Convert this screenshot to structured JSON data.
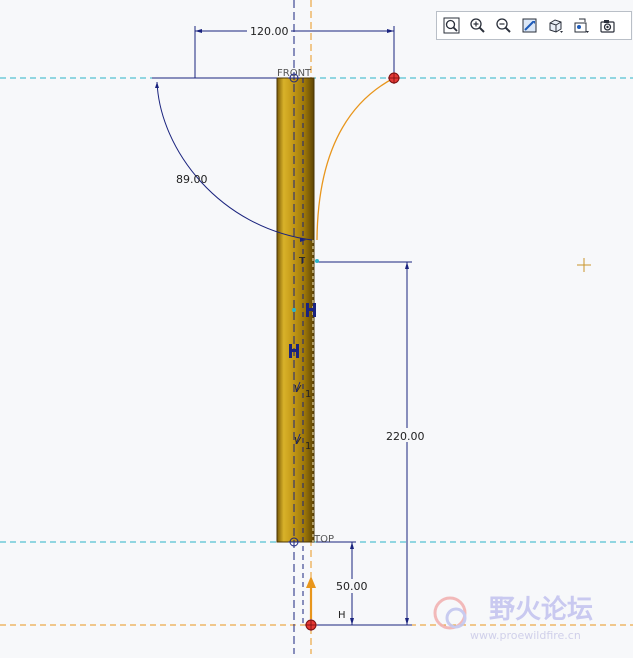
{
  "toolbar": {
    "buttons": [
      {
        "icon": "zoom-fit-icon"
      },
      {
        "icon": "zoom-in-icon"
      },
      {
        "icon": "zoom-out-icon"
      },
      {
        "icon": "repaint-icon"
      },
      {
        "icon": "display-style-icon"
      },
      {
        "icon": "view-options-icon"
      },
      {
        "icon": "saved-views-icon"
      }
    ]
  },
  "sketch": {
    "datum_planes": {
      "front": "FRONT",
      "top": "TOP"
    },
    "dimensions": {
      "horizontal_width": "120.00",
      "arc_angle": "89.00",
      "vertical_length": "220.00",
      "offset_height": "50.00"
    },
    "constraints": {
      "tangent": "T",
      "horizontal": "H",
      "vertical_a": "V",
      "vertical_b": "V",
      "parallel_a": "1",
      "parallel_b": "1"
    },
    "colors": {
      "sweep_body": "#c9a21e",
      "datum_line": "#2bb5c8",
      "dimension": "#1a237e",
      "trajectory": "#e8961c",
      "endpoint": "#e53935"
    }
  },
  "watermark": {
    "title": "野火论坛",
    "url": "www.proewildfire.cn"
  }
}
